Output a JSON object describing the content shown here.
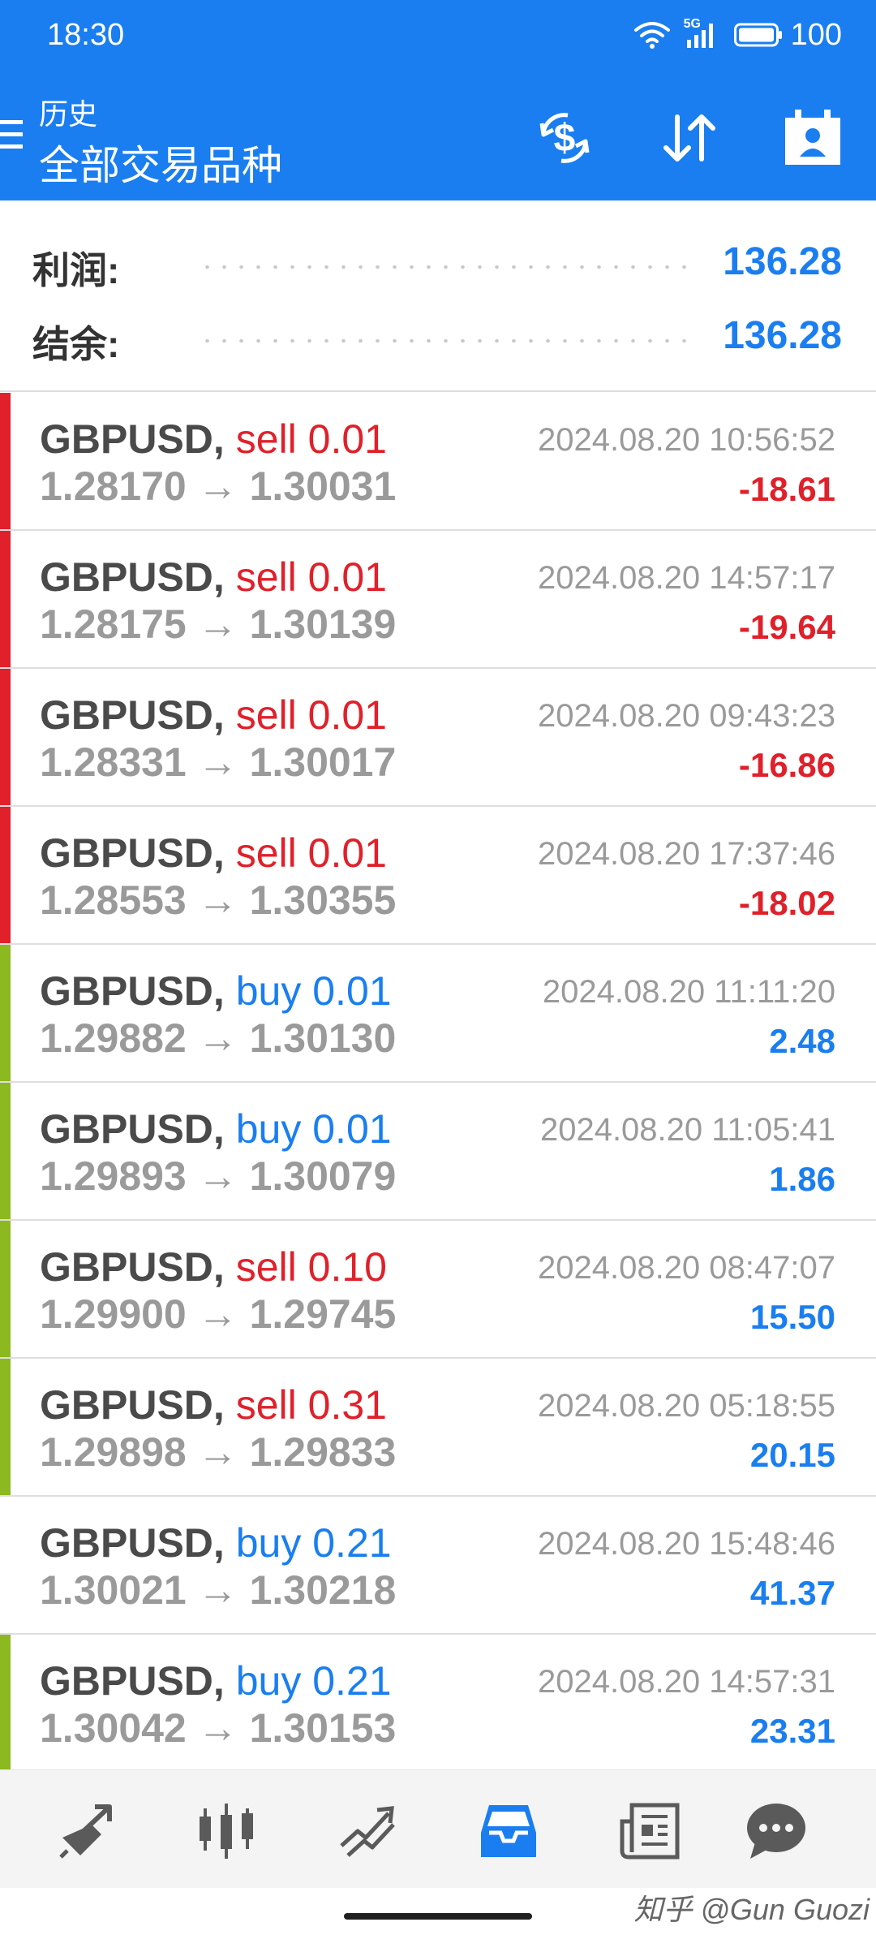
{
  "status_bar": {
    "time": "18:30",
    "network": "5G",
    "battery": "100",
    "icons": [
      "wifi-icon",
      "signal-icon",
      "battery-icon"
    ]
  },
  "toolbar": {
    "subtitle": "历史",
    "title": "全部交易品种",
    "icons": [
      "menu-icon",
      "currency-icon",
      "sort-icon",
      "contact-icon"
    ]
  },
  "summary": {
    "profit_label": "利润:",
    "profit_value": "136.28",
    "balance_label": "结余:",
    "balance_value": "136.28"
  },
  "colors": {
    "accent": "#1a7ef0",
    "sell": "#e0202a",
    "buy": "#1a7ef0",
    "loss_marker": "#e0202a",
    "profit_marker": "#8cb820",
    "muted_text": "#9a9a9a"
  },
  "deals": [
    {
      "symbol": "GBPUSD,",
      "type": "sell",
      "volume": "0.01",
      "open_price": "1.28170",
      "arrow": "→",
      "close_price": "1.30031",
      "time": "2024.08.20 10:56:52",
      "profit": "-18.61",
      "marker": "loss"
    },
    {
      "symbol": "GBPUSD,",
      "type": "sell",
      "volume": "0.01",
      "open_price": "1.28175",
      "arrow": "→",
      "close_price": "1.30139",
      "time": "2024.08.20 14:57:17",
      "profit": "-19.64",
      "marker": "loss"
    },
    {
      "symbol": "GBPUSD,",
      "type": "sell",
      "volume": "0.01",
      "open_price": "1.28331",
      "arrow": "→",
      "close_price": "1.30017",
      "time": "2024.08.20 09:43:23",
      "profit": "-16.86",
      "marker": "loss"
    },
    {
      "symbol": "GBPUSD,",
      "type": "sell",
      "volume": "0.01",
      "open_price": "1.28553",
      "arrow": "→",
      "close_price": "1.30355",
      "time": "2024.08.20 17:37:46",
      "profit": "-18.02",
      "marker": "loss"
    },
    {
      "symbol": "GBPUSD,",
      "type": "buy",
      "volume": "0.01",
      "open_price": "1.29882",
      "arrow": "→",
      "close_price": "1.30130",
      "time": "2024.08.20 11:11:20",
      "profit": "2.48",
      "marker": "profit"
    },
    {
      "symbol": "GBPUSD,",
      "type": "buy",
      "volume": "0.01",
      "open_price": "1.29893",
      "arrow": "→",
      "close_price": "1.30079",
      "time": "2024.08.20 11:05:41",
      "profit": "1.86",
      "marker": "profit"
    },
    {
      "symbol": "GBPUSD,",
      "type": "sell",
      "volume": "0.10",
      "open_price": "1.29900",
      "arrow": "→",
      "close_price": "1.29745",
      "time": "2024.08.20 08:47:07",
      "profit": "15.50",
      "marker": "profit"
    },
    {
      "symbol": "GBPUSD,",
      "type": "sell",
      "volume": "0.31",
      "open_price": "1.29898",
      "arrow": "→",
      "close_price": "1.29833",
      "time": "2024.08.20 05:18:55",
      "profit": "20.15",
      "marker": "profit"
    },
    {
      "symbol": "GBPUSD,",
      "type": "buy",
      "volume": "0.21",
      "open_price": "1.30021",
      "arrow": "→",
      "close_price": "1.30218",
      "time": "2024.08.20 15:48:46",
      "profit": "41.37",
      "marker": "none"
    },
    {
      "symbol": "GBPUSD,",
      "type": "buy",
      "volume": "0.21",
      "open_price": "1.30042",
      "arrow": "→",
      "close_price": "1.30153",
      "time": "2024.08.20 14:57:31",
      "profit": "23.31",
      "marker": "profit"
    }
  ],
  "bottom_nav": {
    "tabs": [
      {
        "icon": "quotes-icon",
        "active": false
      },
      {
        "icon": "chart-icon",
        "active": false
      },
      {
        "icon": "trade-icon",
        "active": false
      },
      {
        "icon": "history-icon",
        "active": true
      },
      {
        "icon": "news-icon",
        "active": false
      },
      {
        "icon": "messages-icon",
        "active": false
      }
    ]
  },
  "watermark": "知乎 @Gun Guozi"
}
